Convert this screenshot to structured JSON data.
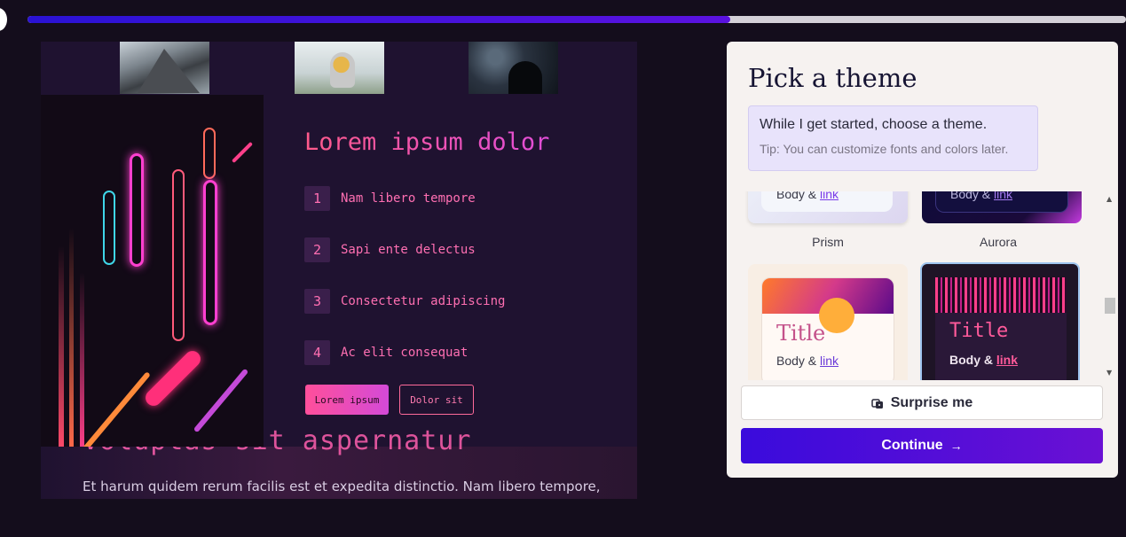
{
  "progress": {
    "percent": 64
  },
  "preview": {
    "heading": "Lorem ipsum dolor",
    "items": [
      {
        "num": "1",
        "text": "Nam libero tempore"
      },
      {
        "num": "2",
        "text": "Sapi ente delectus"
      },
      {
        "num": "3",
        "text": "Consectetur adipiscing"
      },
      {
        "num": "4",
        "text": "Ac elit consequat"
      }
    ],
    "primary_button": "Lorem ipsum",
    "outline_button": "Dolor sit",
    "lower_heading": "Voluptas sit aspernatur",
    "paragraph": "Et harum quidem rerum facilis est et expedita distinctio. Nam libero tempore,"
  },
  "panel": {
    "title": "Pick a theme",
    "tip_main": "While I get started, choose a theme.",
    "tip_sub": "Tip: You can customize fonts and colors later.",
    "themes": [
      {
        "name": "Prism",
        "body": "Body &",
        "link": "link"
      },
      {
        "name": "Aurora",
        "body": "Body &",
        "link": "link"
      },
      {
        "title": "Title",
        "body": "Body &",
        "link": "link",
        "selected": false
      },
      {
        "title": "Title",
        "body": "Body &",
        "link": "link",
        "selected": true
      }
    ],
    "surprise_label": "Surprise me",
    "continue_label": "Continue",
    "continue_arrow": "→"
  },
  "colors": {
    "accent_pink": "#ff5aa0",
    "accent_purple": "#5b12e0",
    "selected_border": "#9ec4ee"
  }
}
